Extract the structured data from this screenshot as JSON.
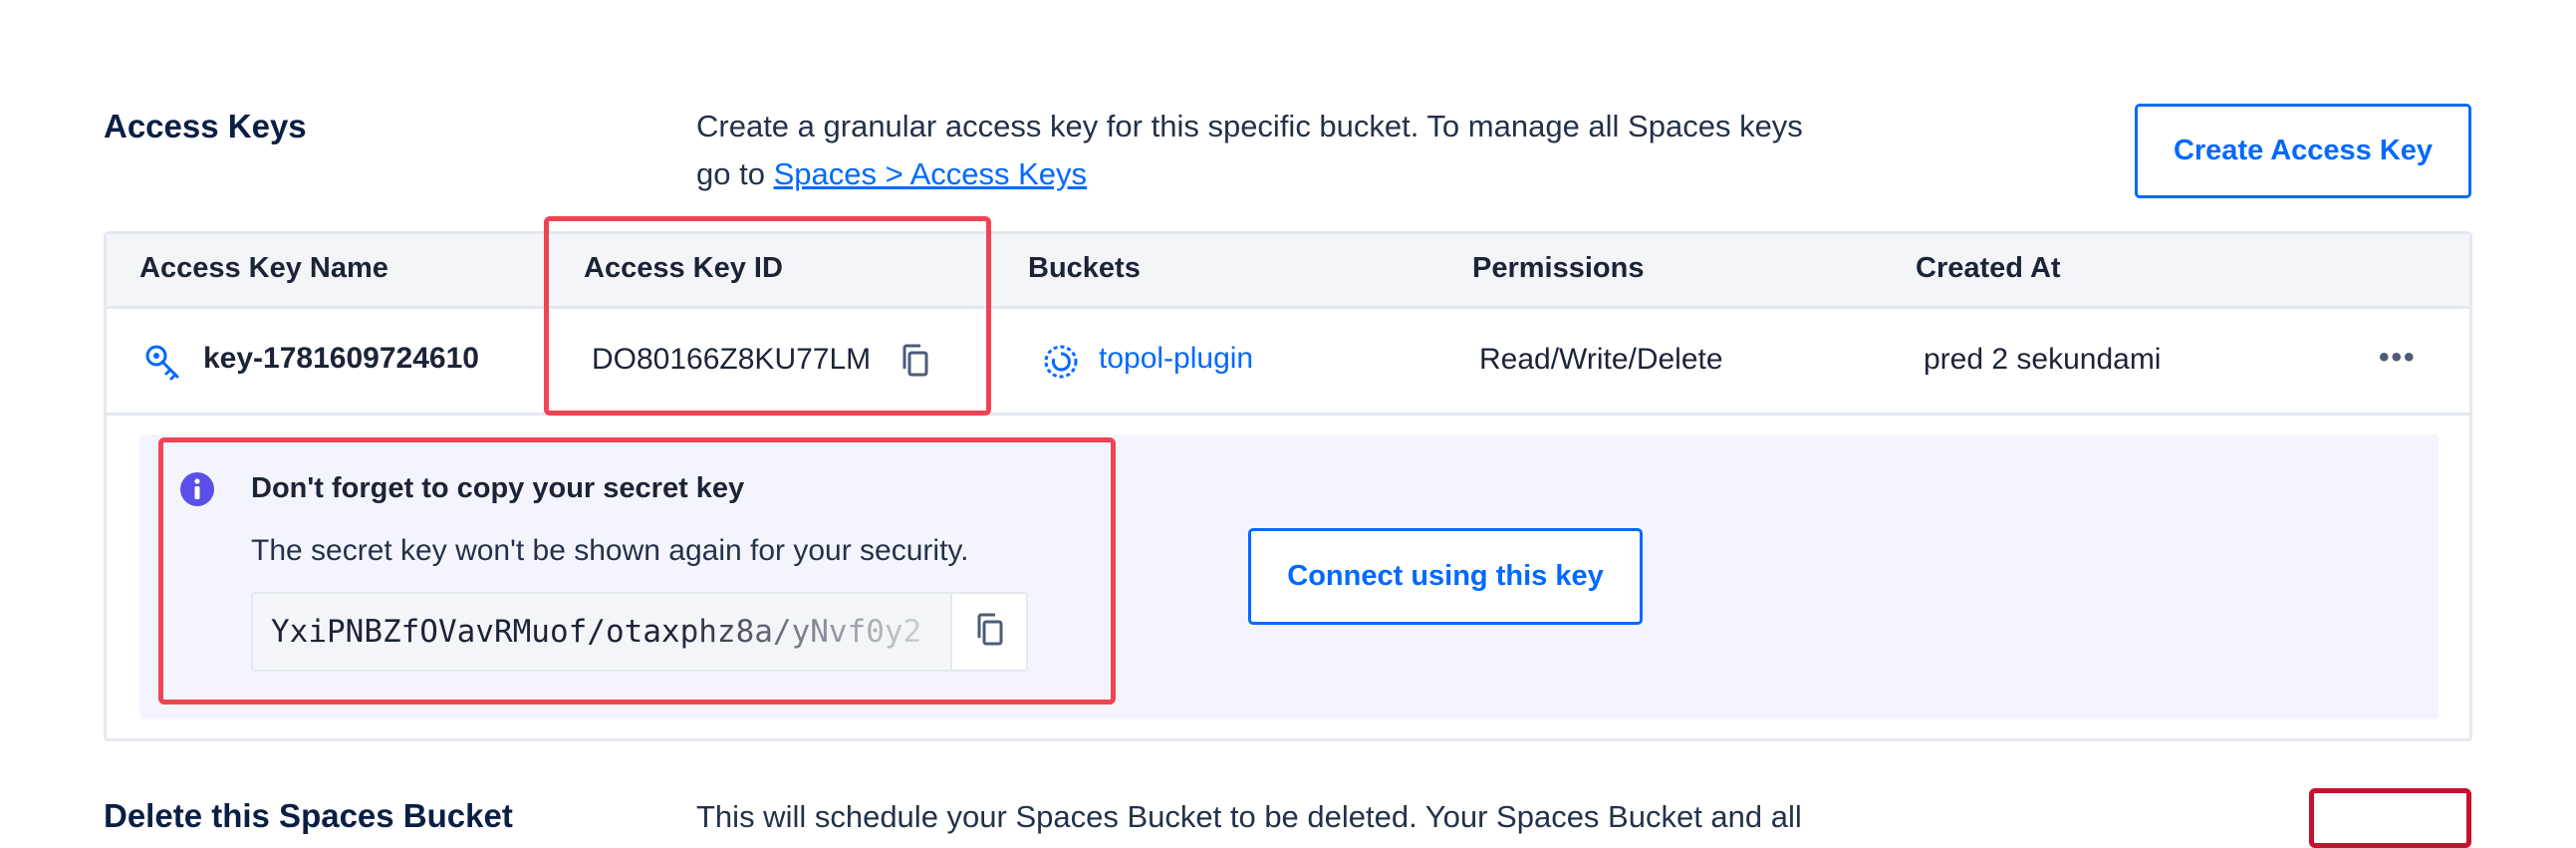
{
  "access_keys": {
    "title": "Access Keys",
    "description_line1": "Create a granular access key for this specific bucket. To manage all Spaces keys",
    "description_prefix": "go to ",
    "description_link": "Spaces > Access Keys",
    "create_button": "Create Access Key"
  },
  "table": {
    "columns": [
      "Access Key Name",
      "Access Key ID",
      "Buckets",
      "Permissions",
      "Created At"
    ],
    "rows": [
      {
        "name": "key-1781609724610",
        "key_id": "DO80166Z8KU77LM",
        "bucket": "topol-plugin",
        "permissions": "Read/Write/Delete",
        "created_at": "pred 2 sekundami",
        "more": "•••"
      }
    ]
  },
  "secret_notice": {
    "title": "Don't forget to copy your secret key",
    "subtitle": "The secret key won't be shown again for your security.",
    "secret_value": "YxiPNBZfOVavRMuof/otaxphz8a/yNvf0y2",
    "connect_button": "Connect using this key"
  },
  "delete_section": {
    "title": "Delete this Spaces Bucket",
    "description": "This will schedule your Spaces Bucket to be deleted. Your Spaces Bucket and all"
  },
  "colors": {
    "accent": "#0069ff",
    "highlight": "#ee4453",
    "info": "#5b4fe9"
  },
  "icons": {
    "key": "key-icon",
    "copy": "copy-icon",
    "bucket": "bucket-icon",
    "info": "info-icon",
    "more": "more-icon"
  }
}
